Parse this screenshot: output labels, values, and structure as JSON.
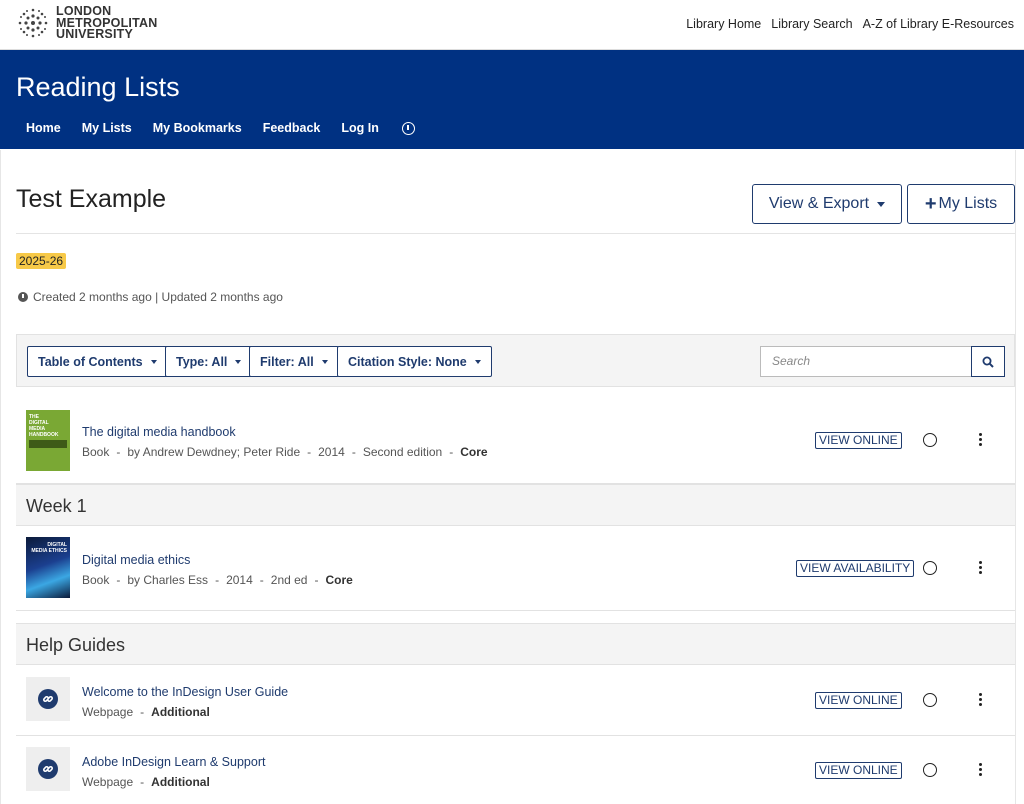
{
  "brand": {
    "logo_lines": [
      "LONDON",
      "METROPOLITAN",
      "UNIVERSITY"
    ]
  },
  "top_links": [
    "Library Home",
    "Library Search",
    "A-Z of Library E-Resources"
  ],
  "header": {
    "title": "Reading Lists",
    "nav": [
      "Home",
      "My Lists",
      "My Bookmarks",
      "Feedback",
      "Log In"
    ]
  },
  "page": {
    "title": "Test Example",
    "view_export_label": "View & Export",
    "my_lists_label": "My Lists",
    "year_badge": "2025-26",
    "meta": "Created 2 months ago | Updated 2 months ago"
  },
  "toolbar": {
    "toc_label": "Table of Contents",
    "type_label": "Type: All",
    "filter_label": "Filter: All",
    "citation_label": "Citation Style: None",
    "search_placeholder": "Search"
  },
  "items": [
    {
      "title": "The digital media handbook",
      "type": "Book",
      "authors": "by Andrew Dewdney; Peter Ride",
      "year": "2014",
      "edition": "Second edition",
      "importance": "Core",
      "action": "VIEW ONLINE",
      "thumb_text": [
        "THE",
        "DIGITAL",
        "MEDIA",
        "HANDBOOK"
      ]
    }
  ],
  "sections": [
    {
      "heading": "Week 1",
      "items": [
        {
          "title": "Digital media ethics",
          "type": "Book",
          "authors": "by Charles Ess",
          "year": "2014",
          "edition": "2nd ed",
          "importance": "Core",
          "action": "VIEW AVAILABILITY",
          "thumb_text": [
            "DIGITAL",
            "MEDIA ETHICS"
          ]
        }
      ]
    },
    {
      "heading": "Help Guides",
      "items": [
        {
          "title": "Welcome to the InDesign User Guide",
          "type": "Webpage",
          "importance": "Additional",
          "action": "VIEW ONLINE"
        },
        {
          "title": "Adobe InDesign Learn & Support",
          "type": "Webpage",
          "importance": "Additional",
          "action": "VIEW ONLINE"
        }
      ]
    }
  ],
  "colors": {
    "header_blue": "#003182",
    "accent_navy": "#1f3b6e",
    "badge_yellow": "#f7c948",
    "book_green": "#7aa834"
  },
  "icons": [
    "accessibility-icon",
    "clock-icon",
    "search-icon",
    "link-icon",
    "checkbox-circle-icon",
    "kebab-menu-icon"
  ]
}
